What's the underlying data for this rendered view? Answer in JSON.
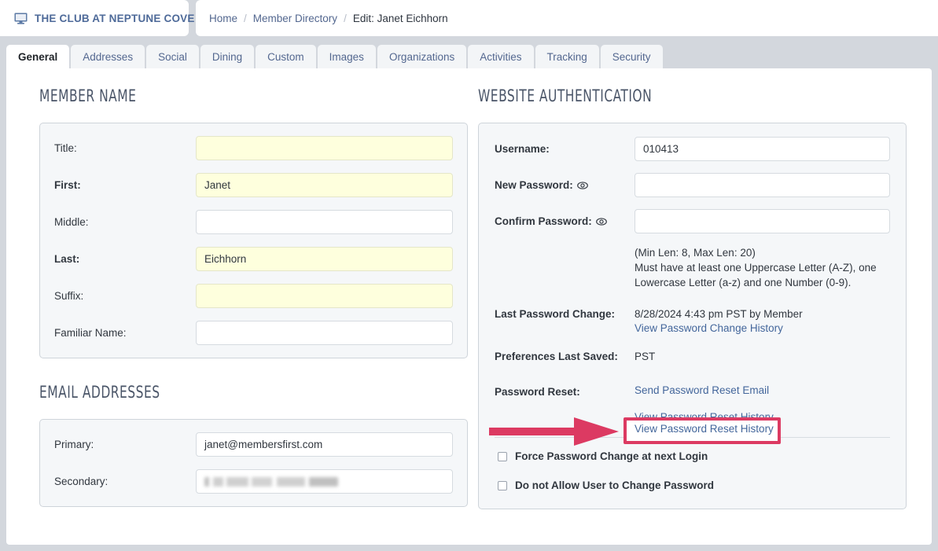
{
  "header": {
    "brand_name": "THE CLUB AT NEPTUNE COVE",
    "brand_icon": "monitor-icon",
    "breadcrumb": {
      "home": "Home",
      "sep1": "/",
      "directory": "Member Directory",
      "sep2": "/",
      "current": "Edit: Janet Eichhorn"
    }
  },
  "tabs": [
    {
      "label": "General",
      "active": true
    },
    {
      "label": "Addresses",
      "active": false
    },
    {
      "label": "Social",
      "active": false
    },
    {
      "label": "Dining",
      "active": false
    },
    {
      "label": "Custom",
      "active": false
    },
    {
      "label": "Images",
      "active": false
    },
    {
      "label": "Organizations",
      "active": false
    },
    {
      "label": "Activities",
      "active": false
    },
    {
      "label": "Tracking",
      "active": false
    },
    {
      "label": "Security",
      "active": false
    }
  ],
  "member_name": {
    "heading": "MEMBER NAME",
    "fields": [
      {
        "label": "Title:",
        "value": "",
        "highlight": true,
        "bold_label": false
      },
      {
        "label": "First:",
        "value": "Janet",
        "highlight": true,
        "bold_label": true
      },
      {
        "label": "Middle:",
        "value": "",
        "highlight": false,
        "bold_label": false
      },
      {
        "label": "Last:",
        "value": "Eichhorn",
        "highlight": true,
        "bold_label": true
      },
      {
        "label": "Suffix:",
        "value": "",
        "highlight": true,
        "bold_label": false
      },
      {
        "label": "Familiar Name:",
        "value": "",
        "highlight": false,
        "bold_label": false
      }
    ]
  },
  "email_addresses": {
    "heading": "EMAIL ADDRESSES",
    "fields": [
      {
        "label": "Primary:",
        "value": "janet@membersfirst.com",
        "redacted": false
      },
      {
        "label": "Secondary:",
        "value": "",
        "redacted": true
      }
    ]
  },
  "website_authentication": {
    "heading": "WEBSITE AUTHENTICATION",
    "username_label": "Username:",
    "username_value": "010413",
    "new_password_label": "New Password:",
    "new_password_value": "",
    "confirm_password_label": "Confirm Password:",
    "confirm_password_value": "",
    "eye_icon": "eye-icon",
    "rules_line1": "(Min Len: 8, Max Len: 20)",
    "rules_line2": "Must have at least one Uppercase Letter (A-Z), one",
    "rules_line3": "Lowercase Letter (a-z) and one Number (0-9).",
    "last_password_change_label": "Last Password Change:",
    "last_password_change_value": "8/28/2024 4:43 pm PST by Member",
    "view_password_change_history": "View Password Change History",
    "preferences_last_saved_label": "Preferences Last Saved:",
    "preferences_last_saved_value": "PST",
    "password_reset_label": "Password Reset:",
    "send_password_reset_email": "Send Password Reset Email",
    "view_password_reset_history": "View Password Reset History",
    "checkboxes": [
      {
        "label": "Force Password Change at next Login",
        "checked": false
      },
      {
        "label": "Do not Allow User to Change Password",
        "checked": false
      }
    ]
  },
  "annotation": {
    "arrow_name": "callout-arrow",
    "highlight_target": "View Password Reset History",
    "color": "#dc3a62"
  },
  "colors": {
    "page_background": "#d3d7dd",
    "panel_background": "#ffffff",
    "field_group_background": "#f5f7f9",
    "highlight_field": "#feffdd",
    "link": "#43669b",
    "brand": "#4e6a99",
    "annotation": "#dc3a62"
  }
}
